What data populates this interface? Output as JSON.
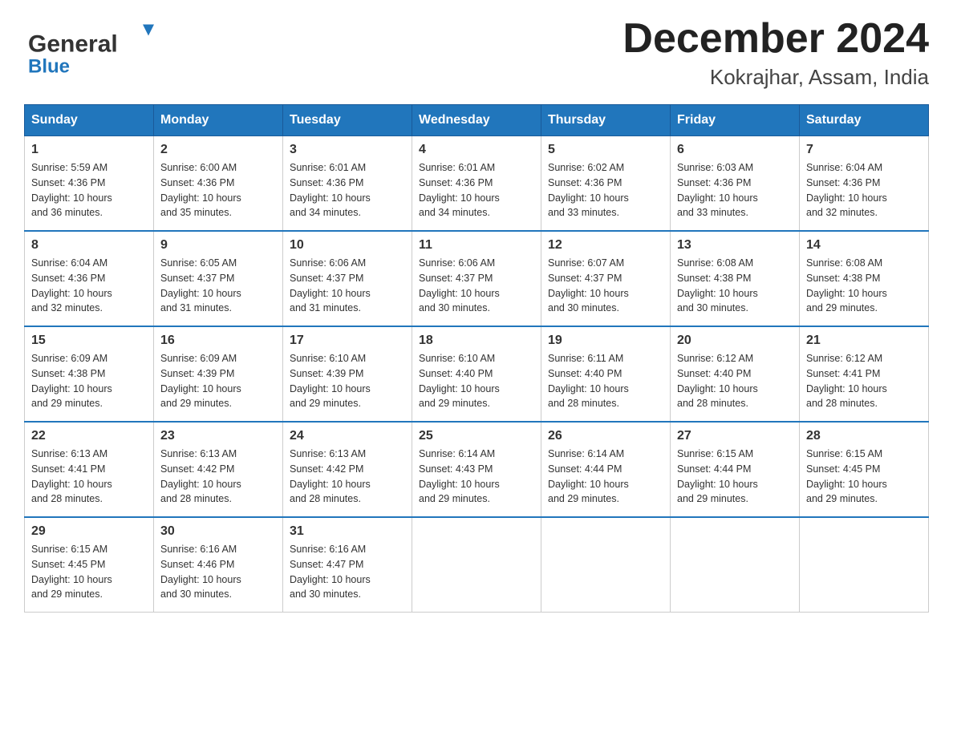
{
  "header": {
    "logo_general": "General",
    "logo_blue": "Blue",
    "title": "December 2024",
    "subtitle": "Kokrajhar, Assam, India"
  },
  "calendar": {
    "days": [
      "Sunday",
      "Monday",
      "Tuesday",
      "Wednesday",
      "Thursday",
      "Friday",
      "Saturday"
    ],
    "weeks": [
      [
        {
          "num": "1",
          "sunrise": "5:59 AM",
          "sunset": "4:36 PM",
          "daylight": "10 hours and 36 minutes."
        },
        {
          "num": "2",
          "sunrise": "6:00 AM",
          "sunset": "4:36 PM",
          "daylight": "10 hours and 35 minutes."
        },
        {
          "num": "3",
          "sunrise": "6:01 AM",
          "sunset": "4:36 PM",
          "daylight": "10 hours and 34 minutes."
        },
        {
          "num": "4",
          "sunrise": "6:01 AM",
          "sunset": "4:36 PM",
          "daylight": "10 hours and 34 minutes."
        },
        {
          "num": "5",
          "sunrise": "6:02 AM",
          "sunset": "4:36 PM",
          "daylight": "10 hours and 33 minutes."
        },
        {
          "num": "6",
          "sunrise": "6:03 AM",
          "sunset": "4:36 PM",
          "daylight": "10 hours and 33 minutes."
        },
        {
          "num": "7",
          "sunrise": "6:04 AM",
          "sunset": "4:36 PM",
          "daylight": "10 hours and 32 minutes."
        }
      ],
      [
        {
          "num": "8",
          "sunrise": "6:04 AM",
          "sunset": "4:36 PM",
          "daylight": "10 hours and 32 minutes."
        },
        {
          "num": "9",
          "sunrise": "6:05 AM",
          "sunset": "4:37 PM",
          "daylight": "10 hours and 31 minutes."
        },
        {
          "num": "10",
          "sunrise": "6:06 AM",
          "sunset": "4:37 PM",
          "daylight": "10 hours and 31 minutes."
        },
        {
          "num": "11",
          "sunrise": "6:06 AM",
          "sunset": "4:37 PM",
          "daylight": "10 hours and 30 minutes."
        },
        {
          "num": "12",
          "sunrise": "6:07 AM",
          "sunset": "4:37 PM",
          "daylight": "10 hours and 30 minutes."
        },
        {
          "num": "13",
          "sunrise": "6:08 AM",
          "sunset": "4:38 PM",
          "daylight": "10 hours and 30 minutes."
        },
        {
          "num": "14",
          "sunrise": "6:08 AM",
          "sunset": "4:38 PM",
          "daylight": "10 hours and 29 minutes."
        }
      ],
      [
        {
          "num": "15",
          "sunrise": "6:09 AM",
          "sunset": "4:38 PM",
          "daylight": "10 hours and 29 minutes."
        },
        {
          "num": "16",
          "sunrise": "6:09 AM",
          "sunset": "4:39 PM",
          "daylight": "10 hours and 29 minutes."
        },
        {
          "num": "17",
          "sunrise": "6:10 AM",
          "sunset": "4:39 PM",
          "daylight": "10 hours and 29 minutes."
        },
        {
          "num": "18",
          "sunrise": "6:10 AM",
          "sunset": "4:40 PM",
          "daylight": "10 hours and 29 minutes."
        },
        {
          "num": "19",
          "sunrise": "6:11 AM",
          "sunset": "4:40 PM",
          "daylight": "10 hours and 28 minutes."
        },
        {
          "num": "20",
          "sunrise": "6:12 AM",
          "sunset": "4:40 PM",
          "daylight": "10 hours and 28 minutes."
        },
        {
          "num": "21",
          "sunrise": "6:12 AM",
          "sunset": "4:41 PM",
          "daylight": "10 hours and 28 minutes."
        }
      ],
      [
        {
          "num": "22",
          "sunrise": "6:13 AM",
          "sunset": "4:41 PM",
          "daylight": "10 hours and 28 minutes."
        },
        {
          "num": "23",
          "sunrise": "6:13 AM",
          "sunset": "4:42 PM",
          "daylight": "10 hours and 28 minutes."
        },
        {
          "num": "24",
          "sunrise": "6:13 AM",
          "sunset": "4:42 PM",
          "daylight": "10 hours and 28 minutes."
        },
        {
          "num": "25",
          "sunrise": "6:14 AM",
          "sunset": "4:43 PM",
          "daylight": "10 hours and 29 minutes."
        },
        {
          "num": "26",
          "sunrise": "6:14 AM",
          "sunset": "4:44 PM",
          "daylight": "10 hours and 29 minutes."
        },
        {
          "num": "27",
          "sunrise": "6:15 AM",
          "sunset": "4:44 PM",
          "daylight": "10 hours and 29 minutes."
        },
        {
          "num": "28",
          "sunrise": "6:15 AM",
          "sunset": "4:45 PM",
          "daylight": "10 hours and 29 minutes."
        }
      ],
      [
        {
          "num": "29",
          "sunrise": "6:15 AM",
          "sunset": "4:45 PM",
          "daylight": "10 hours and 29 minutes."
        },
        {
          "num": "30",
          "sunrise": "6:16 AM",
          "sunset": "4:46 PM",
          "daylight": "10 hours and 30 minutes."
        },
        {
          "num": "31",
          "sunrise": "6:16 AM",
          "sunset": "4:47 PM",
          "daylight": "10 hours and 30 minutes."
        },
        null,
        null,
        null,
        null
      ]
    ],
    "labels": {
      "sunrise": "Sunrise:",
      "sunset": "Sunset:",
      "daylight": "Daylight:"
    }
  }
}
